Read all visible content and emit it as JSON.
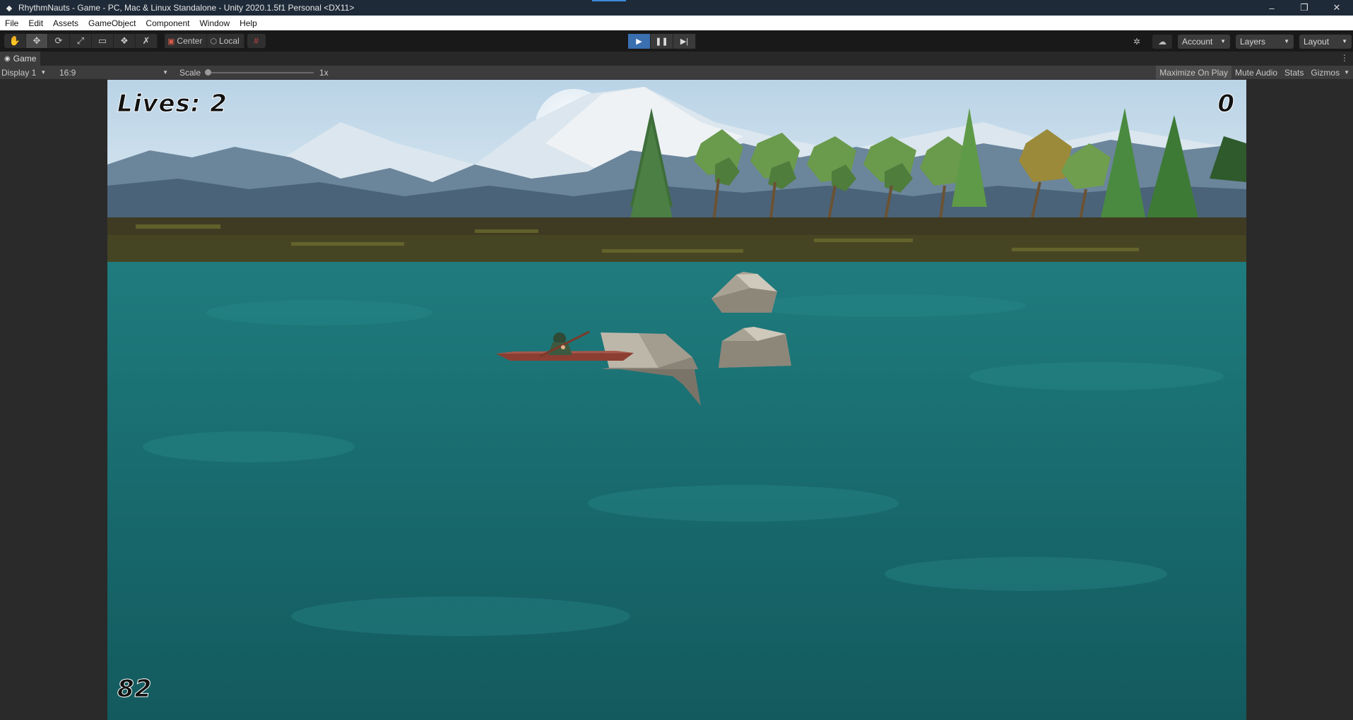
{
  "window": {
    "title": "RhythmNauts - Game - PC, Mac & Linux Standalone - Unity 2020.1.5f1 Personal <DX11>",
    "minimize": "–",
    "restore": "❐",
    "close": "✕"
  },
  "menu": [
    "File",
    "Edit",
    "Assets",
    "GameObject",
    "Component",
    "Window",
    "Help"
  ],
  "toolbar": {
    "tools": [
      {
        "name": "hand-tool",
        "glyph": "✋"
      },
      {
        "name": "move-tool",
        "glyph": "✥"
      },
      {
        "name": "rotate-tool",
        "glyph": "⟳"
      },
      {
        "name": "scale-tool",
        "glyph": "⤢"
      },
      {
        "name": "rect-tool",
        "glyph": "▭"
      },
      {
        "name": "transform-tool",
        "glyph": "❖"
      },
      {
        "name": "custom-tool",
        "glyph": "✗"
      }
    ],
    "pivot_label": "Center",
    "space_label": "Local",
    "account_label": "Account",
    "layers_label": "Layers",
    "layout_label": "Layout"
  },
  "tab": {
    "label": "Game"
  },
  "gamebar": {
    "display_label": "Display 1",
    "aspect_label": "16:9",
    "scale_label": "Scale",
    "scale_value": "1x",
    "maximize_label": "Maximize On Play",
    "mute_label": "Mute Audio",
    "stats_label": "Stats",
    "gizmos_label": "Gizmos"
  },
  "hud": {
    "lives": "Lives: 2",
    "score": "0",
    "counter": "82"
  },
  "colors": {
    "play_active": "#3a6fb0",
    "water": "#1a6e72",
    "sky": "#c7dcea"
  }
}
